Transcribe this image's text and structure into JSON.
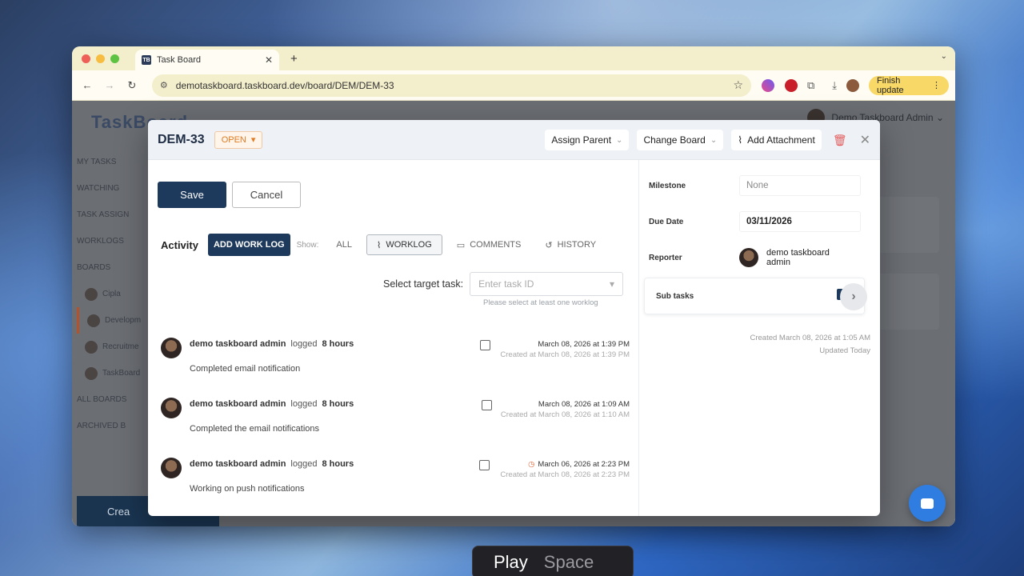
{
  "browser": {
    "tab_title": "Task Board",
    "favicon_text": "TB",
    "url": "demotaskboard.taskboard.dev/board/DEM/DEM-33",
    "finish_update": "Finish update"
  },
  "background_app": {
    "logo": "TaskBoard",
    "user_name": "Demo Taskboard Admin",
    "sidebar": [
      "MY TASKS",
      "WATCHING",
      "TASK ASSIGN",
      "WORKLOGS",
      "BOARDS"
    ],
    "projects": [
      "Cipla",
      "Developm",
      "Recruitme",
      "TaskBoard"
    ],
    "sidebar_footer": [
      "ALL BOARDS",
      "ARCHIVED B"
    ],
    "create_label": "Crea"
  },
  "modal": {
    "ticket_id": "DEM-33",
    "status": "OPEN",
    "assign_parent": "Assign Parent",
    "change_board": "Change Board",
    "add_attachment": "Add Attachment",
    "save": "Save",
    "cancel": "Cancel",
    "activity": "Activity",
    "add_work_log": "ADD WORK LOG",
    "show": "Show:",
    "filters": [
      "ALL",
      "WORKLOG",
      "COMMENTS",
      "HISTORY"
    ],
    "active_filter": "WORKLOG",
    "target_label": "Select target task:",
    "target_placeholder": "Enter task ID",
    "target_hint": "Please select at least one worklog",
    "logs": [
      {
        "user": "demo taskboard admin",
        "verb": "logged",
        "hours": "8 hours",
        "description": "Completed email notification",
        "date": "March 08, 2026 at 1:39 PM",
        "created": "Created at March 08, 2026 at 1:39 PM"
      },
      {
        "user": "demo taskboard admin",
        "verb": "logged",
        "hours": "8 hours",
        "description": "Completed the email notifications",
        "date": "March 08, 2026 at 1:09 AM",
        "created": "Created at March 08, 2026 at 1:10 AM"
      },
      {
        "user": "demo taskboard admin",
        "verb": "logged",
        "hours": "8 hours",
        "description": "Working on push notifications",
        "date": "March 06, 2026 at 2:23 PM",
        "created": "Created at March 08, 2026 at 2:23 PM"
      }
    ],
    "properties": {
      "milestone_label": "Milestone",
      "milestone_value": "None",
      "due_date_label": "Due Date",
      "due_date_value": "03/11/2026",
      "reporter_label": "Reporter",
      "reporter_value": "demo taskboard admin",
      "subtasks_label": "Sub tasks"
    },
    "created_meta": "Created March 08, 2026 at 1:05 AM",
    "updated_meta": "Updated Today"
  },
  "overlay": {
    "key_primary": "Play",
    "key_secondary": "Space"
  },
  "colors": {
    "primary": "#1d3a5c",
    "status_orange": "#e17a22",
    "chat_blue": "#2f7de0"
  }
}
